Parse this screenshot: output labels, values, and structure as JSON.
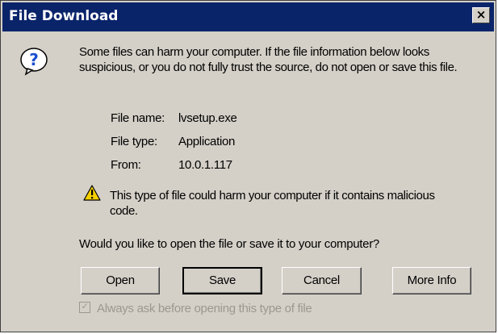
{
  "window": {
    "title": "File Download",
    "close_label": "×"
  },
  "message": "Some files can harm your computer. If the file information below looks suspicious, or you do not fully trust the source, do not open or save this file.",
  "file_info": [
    {
      "label": "File name:",
      "value": "lvsetup.exe"
    },
    {
      "label": "File type:",
      "value": "Application"
    },
    {
      "label": "From:",
      "value": "10.0.1.117"
    }
  ],
  "warning": "This type of file could harm your computer if it contains malicious code.",
  "prompt": "Would you like to open the file or save it to your computer?",
  "buttons": {
    "open": "Open",
    "save": "Save",
    "cancel": "Cancel",
    "more_info": "More Info"
  },
  "checkbox": {
    "label": "Always ask before opening this type of file",
    "checked": true,
    "check_glyph": "✓"
  },
  "icons": {
    "question": "question-icon",
    "warning": "warning-icon"
  },
  "colors": {
    "titlebar": "#0a246a",
    "dialog_bg": "#d4d0c8",
    "icon_blue": "#1c4fd0",
    "warning_yellow": "#f5d000"
  }
}
